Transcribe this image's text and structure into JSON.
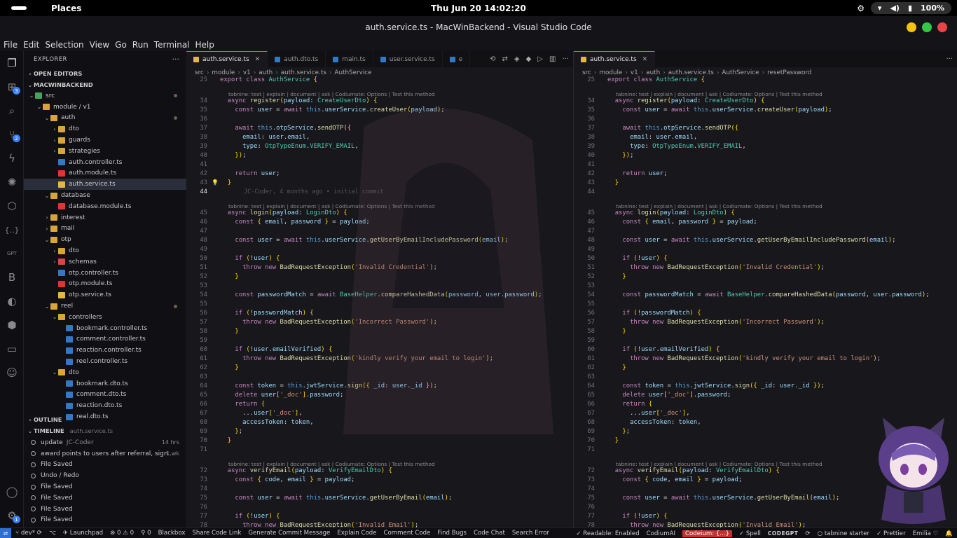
{
  "system_bar": {
    "app": "Places",
    "clock": "Thu Jun 20  14:02:20",
    "battery": "100%"
  },
  "window": {
    "title": "auth.service.ts - MacWinBackend - Visual Studio Code"
  },
  "menu": [
    "File",
    "Edit",
    "Selection",
    "View",
    "Go",
    "Run",
    "Terminal",
    "Help"
  ],
  "activity_badges": {
    "extensions": "3",
    "source_control": "2",
    "settings": "1"
  },
  "sidebar": {
    "title": "EXPLORER",
    "open_editors": "OPEN EDITORS",
    "project": "MACWINBACKEND",
    "tree": [
      {
        "label": "src",
        "type": "folder"
      },
      {
        "label": "module / v1",
        "type": "folder"
      },
      {
        "label": "auth",
        "type": "folder"
      },
      {
        "label": "dto",
        "type": "folder"
      },
      {
        "label": "guards",
        "type": "folder"
      },
      {
        "label": "strategies",
        "type": "folder"
      },
      {
        "label": "auth.controller.ts",
        "type": "ts"
      },
      {
        "label": "auth.module.ts",
        "type": "ng"
      },
      {
        "label": "auth.service.ts",
        "type": "svc"
      },
      {
        "label": "database",
        "type": "folder"
      },
      {
        "label": "database.module.ts",
        "type": "ng"
      },
      {
        "label": "interest",
        "type": "folder"
      },
      {
        "label": "mail",
        "type": "folder"
      },
      {
        "label": "otp",
        "type": "folder"
      },
      {
        "label": "dto",
        "type": "folder"
      },
      {
        "label": "schemas",
        "type": "folder"
      },
      {
        "label": "otp.controller.ts",
        "type": "ts"
      },
      {
        "label": "otp.module.ts",
        "type": "ng"
      },
      {
        "label": "otp.service.ts",
        "type": "svc"
      },
      {
        "label": "reel",
        "type": "folder"
      },
      {
        "label": "controllers",
        "type": "folder"
      },
      {
        "label": "bookmark.controller.ts",
        "type": "ts"
      },
      {
        "label": "comment.controller.ts",
        "type": "ts"
      },
      {
        "label": "reaction.controller.ts",
        "type": "ts"
      },
      {
        "label": "reel.controller.ts",
        "type": "ts"
      },
      {
        "label": "dto",
        "type": "folder"
      },
      {
        "label": "bookmark.dto.ts",
        "type": "ts"
      },
      {
        "label": "comment.dto.ts",
        "type": "ts"
      },
      {
        "label": "reaction.dto.ts",
        "type": "ts"
      },
      {
        "label": "real.dto.ts",
        "type": "ts"
      }
    ],
    "outline": "OUTLINE",
    "timeline": "TIMELINE",
    "timeline_file": "auth.service.ts",
    "timeline_items": [
      {
        "label": "update",
        "author": "JC-Coder",
        "time": "14 hrs"
      },
      {
        "label": "award points to users after referral, sign...",
        "author": "",
        "time": "1 wk"
      },
      {
        "label": "File Saved",
        "author": "",
        "time": ""
      },
      {
        "label": "Undo / Redo",
        "author": "",
        "time": ""
      },
      {
        "label": "File Saved",
        "author": "",
        "time": ""
      },
      {
        "label": "File Saved",
        "author": "",
        "time": ""
      },
      {
        "label": "File Saved",
        "author": "",
        "time": ""
      },
      {
        "label": "File Saved",
        "author": "",
        "time": ""
      }
    ]
  },
  "editor_left": {
    "tabs": [
      "auth.service.ts",
      "auth.dto.ts",
      "main.ts",
      "user.service.ts",
      "e"
    ],
    "breadcrumb": [
      "src",
      "module",
      "v1",
      "auth",
      "auth.service.ts",
      "AuthService"
    ]
  },
  "editor_right": {
    "tabs": [
      "auth.service.ts"
    ],
    "breadcrumb": [
      "src",
      "module",
      "v1",
      "auth",
      "auth.service.ts",
      "AuthService",
      "resetPassword"
    ]
  },
  "code": {
    "lens": "tabnine: test | explain | document | ask | Codiumate: Options | Test this method",
    "blame": "JC-Coder, 4 months ago • initial commit",
    "lines": [
      {
        "n": "25",
        "text": "export class AuthService {"
      },
      {
        "n": "34",
        "text": "  async register(payload: CreateUserDto) {",
        "lens": true
      },
      {
        "n": "35",
        "text": "    const user = await this.userService.createUser(payload);"
      },
      {
        "n": "36",
        "text": ""
      },
      {
        "n": "37",
        "text": "    await this.otpService.sendOTP({"
      },
      {
        "n": "38",
        "text": "      email: user.email,"
      },
      {
        "n": "39",
        "text": "      type: OtpTypeEnum.VERIFY_EMAIL,"
      },
      {
        "n": "40",
        "text": "    });"
      },
      {
        "n": "41",
        "text": ""
      },
      {
        "n": "42",
        "text": "    return user;"
      },
      {
        "n": "43",
        "text": "  }"
      },
      {
        "n": "44",
        "text": ""
      },
      {
        "n": "45",
        "text": "  async login(payload: LoginDto) {",
        "lens": true
      },
      {
        "n": "46",
        "text": "    const { email, password } = payload;"
      },
      {
        "n": "47",
        "text": ""
      },
      {
        "n": "48",
        "text": "    const user = await this.userService.getUserByEmailIncludePassword(email);"
      },
      {
        "n": "49",
        "text": ""
      },
      {
        "n": "50",
        "text": "    if (!user) {"
      },
      {
        "n": "51",
        "text": "      throw new BadRequestException('Invalid Credential');"
      },
      {
        "n": "52",
        "text": "    }"
      },
      {
        "n": "53",
        "text": ""
      },
      {
        "n": "54",
        "text": "    const passwordMatch = await BaseHelper.compareHashedData(password, user.password);"
      },
      {
        "n": "55",
        "text": ""
      },
      {
        "n": "56",
        "text": "    if (!passwordMatch) {"
      },
      {
        "n": "57",
        "text": "      throw new BadRequestException('Incorrect Password');"
      },
      {
        "n": "58",
        "text": "    }"
      },
      {
        "n": "59",
        "text": ""
      },
      {
        "n": "60",
        "text": "    if (!user.emailVerified) {"
      },
      {
        "n": "61",
        "text": "      throw new BadRequestException('kindly verify your email to login');"
      },
      {
        "n": "62",
        "text": "    }"
      },
      {
        "n": "63",
        "text": ""
      },
      {
        "n": "64",
        "text": "    const token = this.jwtService.sign({ _id: user._id });"
      },
      {
        "n": "65",
        "text": "    delete user['_doc'].password;"
      },
      {
        "n": "66",
        "text": "    return {"
      },
      {
        "n": "67",
        "text": "      ...user['_doc'],"
      },
      {
        "n": "68",
        "text": "      accessToken: token,"
      },
      {
        "n": "69",
        "text": "    };"
      },
      {
        "n": "70",
        "text": "  }"
      },
      {
        "n": "71",
        "text": ""
      },
      {
        "n": "72",
        "text": "  async verifyEmail(payload: VerifyEmailDto) {",
        "lens": true
      },
      {
        "n": "73",
        "text": "    const { code, email } = payload;"
      },
      {
        "n": "74",
        "text": ""
      },
      {
        "n": "75",
        "text": "    const user = await this.userService.getUserByEmail(email);"
      },
      {
        "n": "76",
        "text": ""
      },
      {
        "n": "77",
        "text": "    if (!user) {"
      },
      {
        "n": "78",
        "text": "      throw new BadRequestException('Invalid Email');"
      }
    ]
  },
  "statusbar": {
    "branch": "dev*",
    "launchpad": "Launchpad",
    "problems": "0 ⚠ 0",
    "ports": "0",
    "left_items": [
      "Blackbox",
      "Share Code Link",
      "Generate Commit Message",
      "Explain Code",
      "Comment Code",
      "Find Bugs",
      "Code Chat",
      "Search Error"
    ],
    "readable": "Readable: Enabled",
    "codium": "CodiumAI",
    "codeium": "Codeium: {...}",
    "spell": "Spell",
    "codegpt": "CODEGPT",
    "tabnine": "tabnine starter",
    "prettier": "Prettier",
    "user": "Emilia"
  }
}
